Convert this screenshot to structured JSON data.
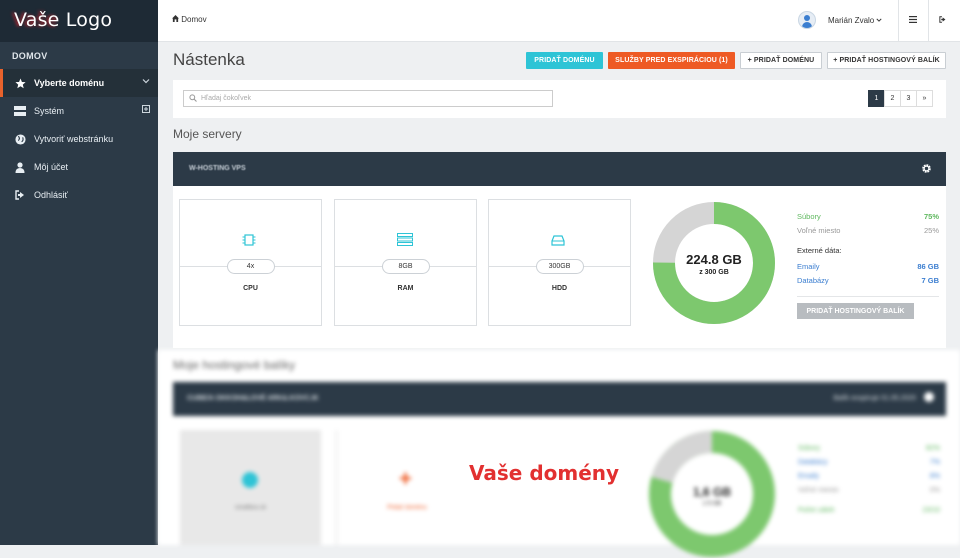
{
  "logo": {
    "text_a": "Vaše",
    "text_b": " Logo"
  },
  "sidebar": {
    "heading": "DOMOV",
    "items": [
      {
        "label": "Vyberte doménu",
        "icon": "star-icon"
      },
      {
        "label": "Systém",
        "icon": "server-icon"
      },
      {
        "label": "Vytvoriť webstránku",
        "icon": "globe-icon"
      },
      {
        "label": "Môj účet",
        "icon": "user-icon"
      },
      {
        "label": "Odhlásiť",
        "icon": "sign-out-icon"
      }
    ]
  },
  "topbar": {
    "breadcrumb": "Domov",
    "user_name": "Marián Zvalo"
  },
  "page": {
    "title": "Nástenka"
  },
  "actions": {
    "add_domain_cyan": "PRIDAŤ DOMÉNU",
    "expiring_services": "SLUŽBY PRED EXSPIRÁCIOU (1)",
    "add_domain": "PRIDAŤ DOMÉNU",
    "add_hosting": "PRIDAŤ HOSTINGOVÝ BALÍK"
  },
  "search": {
    "placeholder": "Hľadaj čokoľvek"
  },
  "pagination": [
    "1",
    "2",
    "3",
    "»"
  ],
  "servers": {
    "section_title": "Moje servery",
    "header_name": "W-HOSTING VPS",
    "cards": [
      {
        "value": "4x",
        "label": "CPU",
        "icon": "chip-icon"
      },
      {
        "value": "8GB",
        "label": "RAM",
        "icon": "memory-icon"
      },
      {
        "value": "300GB",
        "label": "HDD",
        "icon": "hdd-icon"
      }
    ],
    "donut": {
      "center": "224.8 GB",
      "sub": "z 300 GB",
      "used_fraction": 0.75
    },
    "stats": {
      "files_label": "Súbory",
      "files_value": "75%",
      "free_label": "Voľné miesto",
      "free_value": "25%",
      "external_label": "Externé dáta:",
      "emails_label": "Emaily",
      "emails_value": "86 GB",
      "db_label": "Databázy",
      "db_value": "7 GB"
    },
    "add_hosting_button": "PRIDAŤ HOSTINGOVÝ BALÍK"
  },
  "hosting": {
    "section_title": "Moje hostingové balíky",
    "header_name": "CUBE/A OKKOH&LOVÉ ARK&.KOVC.IK",
    "expiry": "Balík exspiruje 01.05.2020",
    "domain_card": "smallbox.sk",
    "add_card": "Pridať doménu",
    "donut_center": "1,6 GB",
    "donut_sub": "z 5 GB",
    "stats": [
      {
        "label": "Súbory",
        "value": "82%"
      },
      {
        "label": "Databázy",
        "value": "7%"
      },
      {
        "label": "Emaily",
        "value": "8%"
      },
      {
        "label": "Voľné miesto",
        "value": "0%"
      },
      {
        "label": "Počet záloh",
        "value": "23/10"
      }
    ]
  },
  "overlay": {
    "text": "Vaše domény"
  },
  "colors": {
    "sidebar": "#2c3a47",
    "accent_orange": "#ee5a24",
    "cyan": "#2ec4d6",
    "green": "#7dc86e",
    "donut_gray": "#d5d5d5"
  }
}
